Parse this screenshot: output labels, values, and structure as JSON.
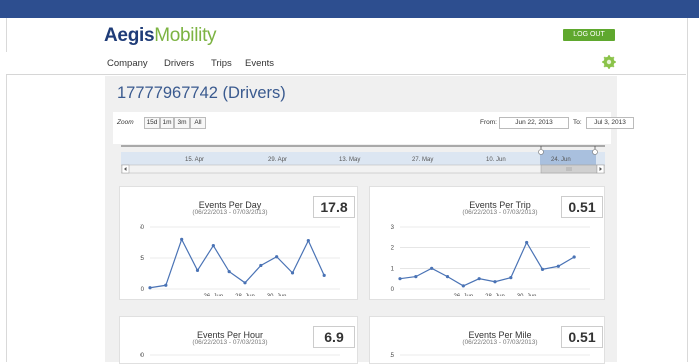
{
  "brand": {
    "part1": "Aegis",
    "part2": "Mobility"
  },
  "header": {
    "logout_label": "LOG OUT"
  },
  "nav": {
    "items": [
      "Company",
      "Drivers",
      "Trips",
      "Events"
    ]
  },
  "page": {
    "title": "17777967742 (Drivers)"
  },
  "zoom": {
    "label": "Zoom",
    "buttons": [
      "15d",
      "1m",
      "3m",
      "All"
    ],
    "from_label": "From:",
    "from_value": "Jun 22, 2013",
    "to_label": "To:",
    "to_value": "Jul 3, 2013",
    "navigator_ticks": [
      "15. Apr",
      "29. Apr",
      "13. May",
      "27. May",
      "10. Jun",
      "24. Jun"
    ]
  },
  "cards": [
    {
      "title": "Events Per Day",
      "subtitle": "(06/22/2013 - 07/03/2013)",
      "value": "17.8"
    },
    {
      "title": "Events Per Trip",
      "subtitle": "(06/22/2013 - 07/03/2013)",
      "value": "0.51"
    },
    {
      "title": "Events Per Hour",
      "subtitle": "(06/22/2013 - 07/03/2013)",
      "value": "6.9"
    },
    {
      "title": "Events Per Mile",
      "subtitle": "(06/22/2013 - 07/03/2013)",
      "value": "0.51"
    }
  ],
  "chart_data": [
    {
      "type": "line",
      "title": "Events Per Day",
      "x": [
        "22. Jun",
        "23. Jun",
        "24. Jun",
        "25. Jun",
        "26. Jun",
        "27. Jun",
        "28. Jun",
        "29. Jun",
        "30. Jun",
        "1. Jul",
        "2. Jul",
        "3. Jul",
        "4. Jul"
      ],
      "values": [
        1,
        3,
        40,
        15,
        35,
        14,
        5,
        19,
        26,
        13,
        39,
        11,
        null
      ],
      "ylim": [
        0,
        50
      ],
      "yticks": [
        0,
        25,
        50
      ],
      "xticks": [
        "26. Jun",
        "28. Jun",
        "30. Jun"
      ],
      "color": "#4a73b5"
    },
    {
      "type": "line",
      "title": "Events Per Trip",
      "x": [
        "22. Jun",
        "23. Jun",
        "24. Jun",
        "25. Jun",
        "26. Jun",
        "27. Jun",
        "28. Jun",
        "29. Jun",
        "30. Jun",
        "1. Jul",
        "2. Jul",
        "3. Jul",
        "4. Jul"
      ],
      "values": [
        0.5,
        0.6,
        1.0,
        0.6,
        0.15,
        0.5,
        0.35,
        0.55,
        2.25,
        0.95,
        1.1,
        1.55,
        null
      ],
      "ylim": [
        0,
        3
      ],
      "yticks": [
        0,
        1,
        2,
        3
      ],
      "xticks": [
        "26. Jun",
        "28. Jun",
        "30. Jun"
      ],
      "color": "#4a73b5"
    },
    {
      "type": "line",
      "title": "Events Per Hour",
      "yticks": [
        200
      ],
      "ylim": [
        0,
        200
      ],
      "values": []
    },
    {
      "type": "line",
      "title": "Events Per Mile",
      "yticks": [
        15
      ],
      "ylim": [
        0,
        15
      ],
      "values": []
    }
  ]
}
